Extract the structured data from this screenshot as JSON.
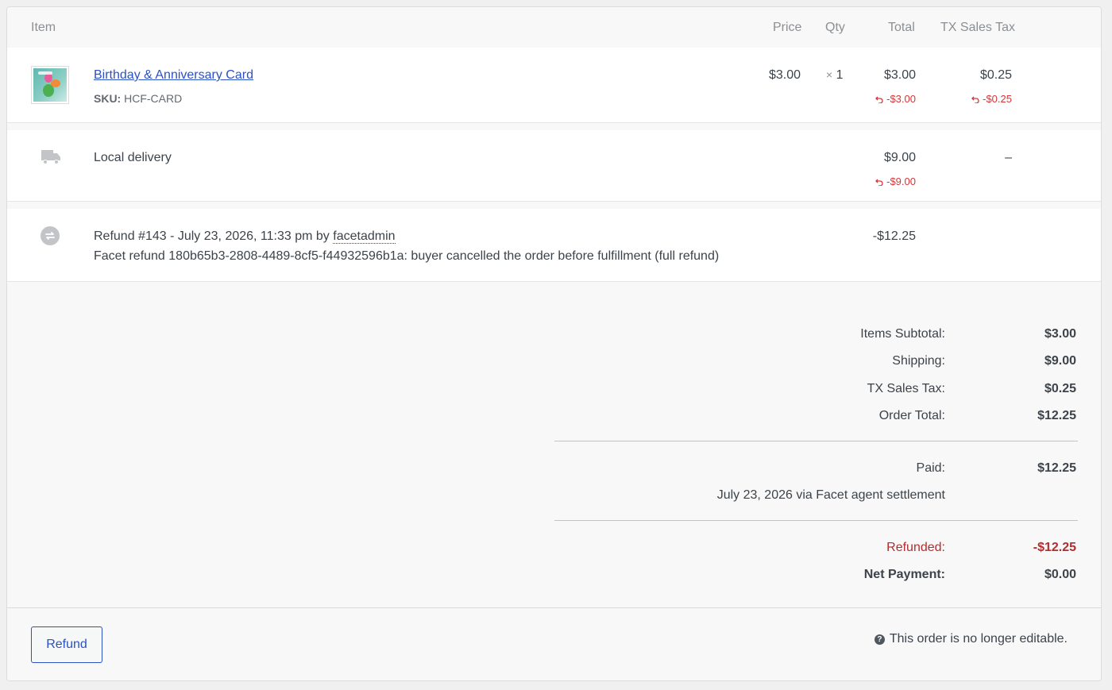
{
  "columns": {
    "item": "Item",
    "price": "Price",
    "qty": "Qty",
    "total": "Total",
    "tax": "TX Sales Tax"
  },
  "line_item": {
    "name": "Birthday & Anniversary Card",
    "sku_label": "SKU:",
    "sku": "HCF-CARD",
    "price": "$3.00",
    "qty_prefix": "×",
    "qty": "1",
    "total": "$3.00",
    "total_refunded": "-$3.00",
    "tax": "$0.25",
    "tax_refunded": "-$0.25"
  },
  "shipping": {
    "name": "Local delivery",
    "total": "$9.00",
    "total_refunded": "-$9.00",
    "tax": "–"
  },
  "refund": {
    "title": "Refund #143 - July 23, 2026, 11:33 pm by",
    "by_user": "facetadmin",
    "note": "Facet refund 180b65b3-2808-4489-8cf5-f44932596b1a: buyer cancelled the order before fulfillment (full refund)",
    "amount": "-$12.25"
  },
  "totals": {
    "items_subtotal_label": "Items Subtotal:",
    "items_subtotal": "$3.00",
    "shipping_label": "Shipping:",
    "shipping": "$9.00",
    "tax_label": "TX Sales Tax:",
    "tax": "$0.25",
    "order_total_label": "Order Total:",
    "order_total": "$12.25",
    "paid_label": "Paid:",
    "paid": "$12.25",
    "paid_note": "July 23, 2026 via Facet agent settlement",
    "refunded_label": "Refunded:",
    "refunded": "-$12.25",
    "net_label": "Net Payment:",
    "net": "$0.00"
  },
  "footer": {
    "refund_button": "Refund",
    "notice": "This order is no longer editable."
  },
  "colors": {
    "link": "#2b51c4",
    "refund_red": "#d63638",
    "refunded_total": "#b32d2e"
  }
}
